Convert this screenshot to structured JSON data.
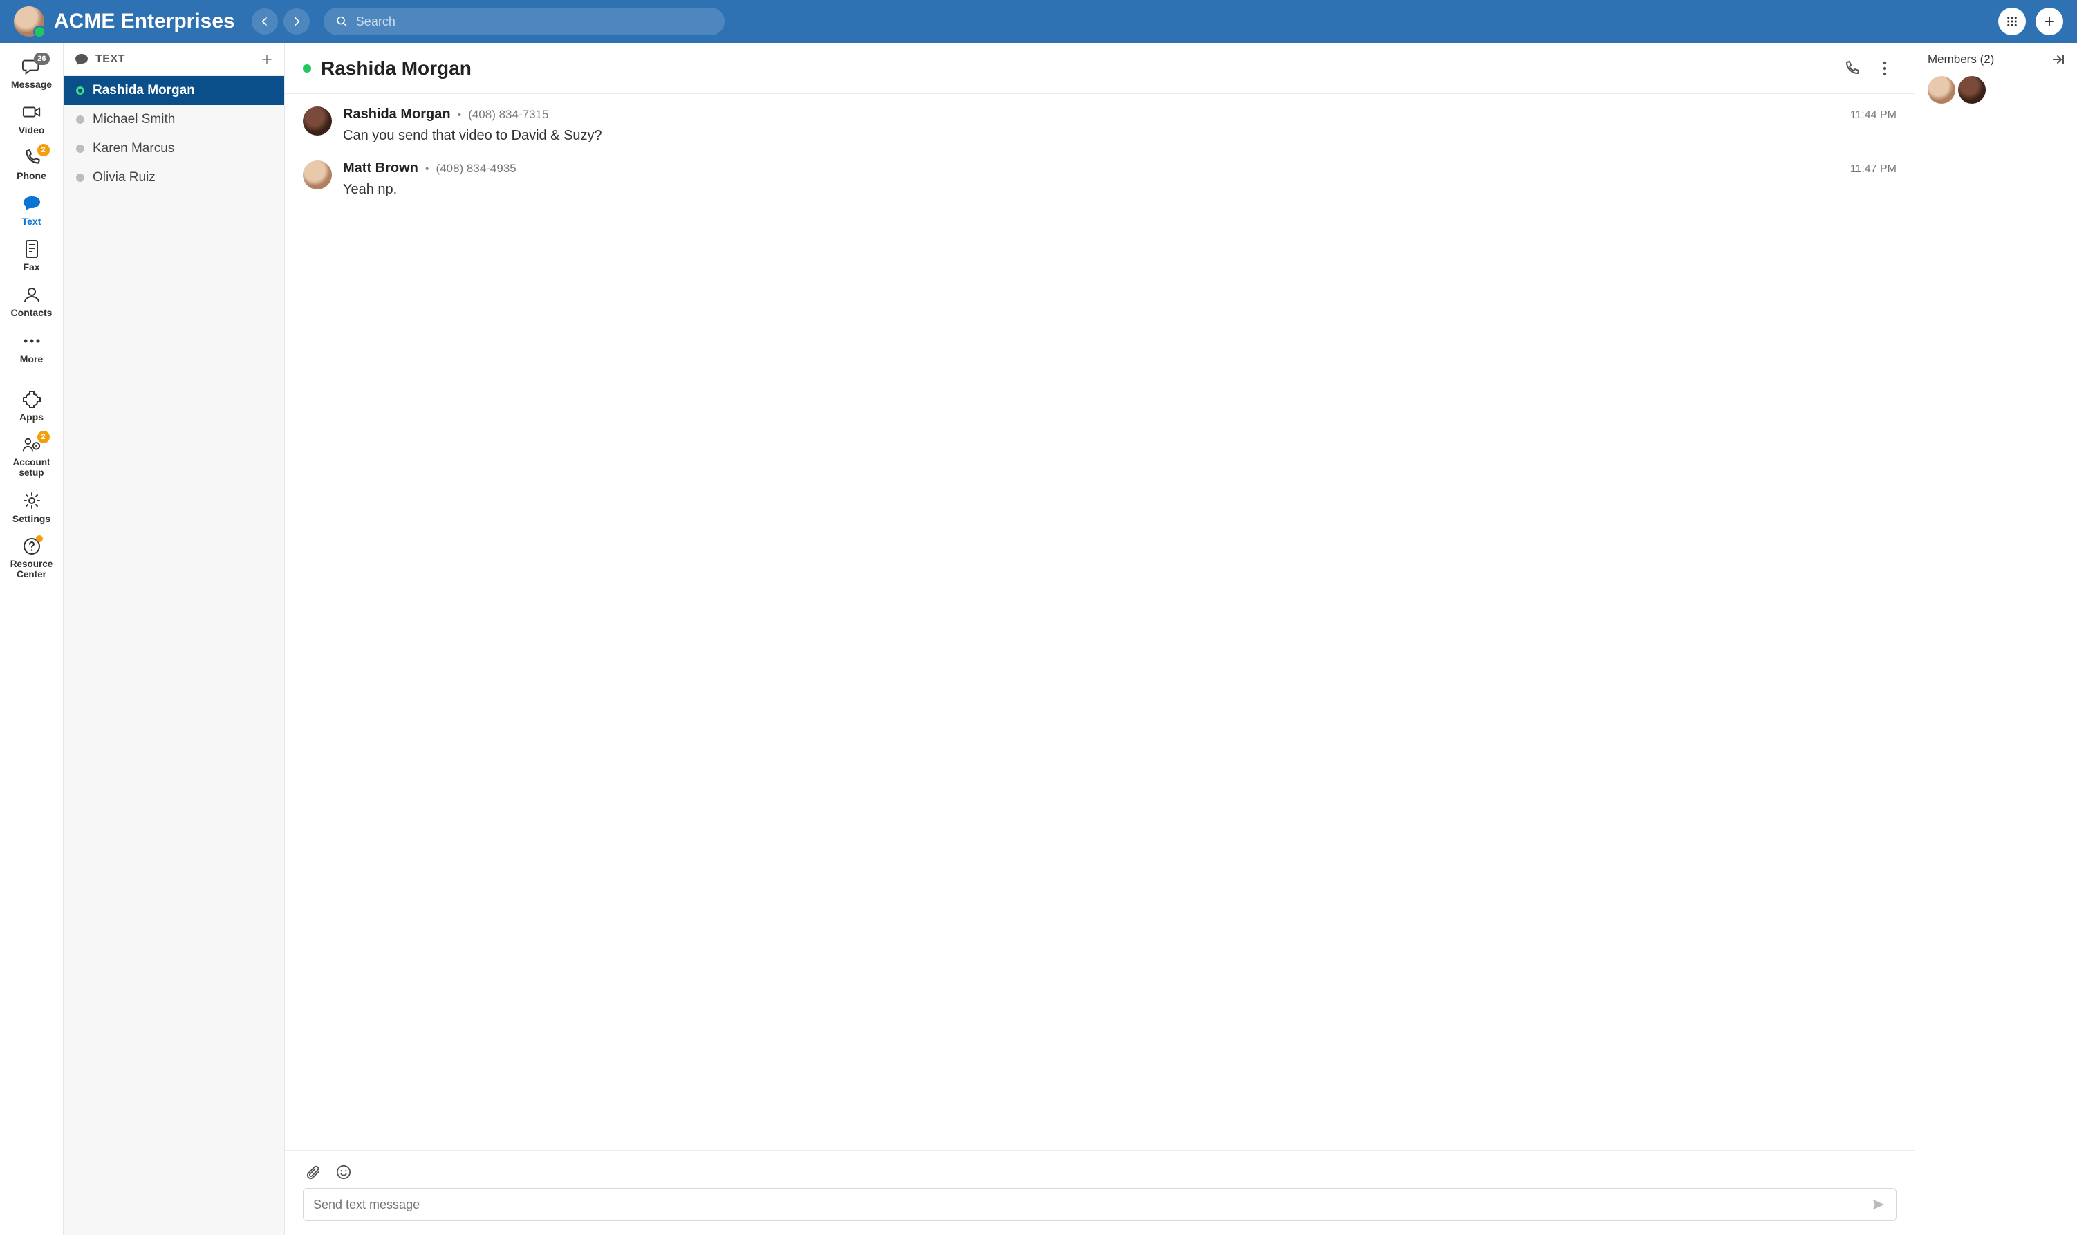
{
  "header": {
    "org_name": "ACME Enterprises",
    "search_placeholder": "Search"
  },
  "rail": {
    "message": {
      "label": "Message",
      "badge": "26"
    },
    "video": {
      "label": "Video"
    },
    "phone": {
      "label": "Phone",
      "badge": "2"
    },
    "text": {
      "label": "Text"
    },
    "fax": {
      "label": "Fax"
    },
    "contacts": {
      "label": "Contacts"
    },
    "more": {
      "label": "More"
    },
    "apps": {
      "label": "Apps"
    },
    "account": {
      "label": "Account setup",
      "badge": "2"
    },
    "settings": {
      "label": "Settings"
    },
    "resource": {
      "label": "Resource Center"
    }
  },
  "convo": {
    "heading": "TEXT",
    "items": [
      {
        "name": "Rashida Morgan",
        "active": true,
        "presence": "online"
      },
      {
        "name": "Michael Smith",
        "active": false,
        "presence": "offline"
      },
      {
        "name": "Karen Marcus",
        "active": false,
        "presence": "offline"
      },
      {
        "name": "Olivia Ruiz",
        "active": false,
        "presence": "offline"
      }
    ]
  },
  "thread": {
    "title": "Rashida Morgan",
    "messages": [
      {
        "name": "Rashida Morgan",
        "phone": "(408) 834-7315",
        "time": "11:44 PM",
        "text": "Can you send that video to David & Suzy?"
      },
      {
        "name": "Matt Brown",
        "phone": "(408) 834-4935",
        "time": "11:47 PM",
        "text": "Yeah np."
      }
    ],
    "compose_placeholder": "Send text message"
  },
  "members": {
    "title": "Members (2)"
  }
}
